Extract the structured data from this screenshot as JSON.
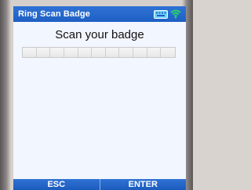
{
  "window": {
    "title": "Ring Scan Badge",
    "status_icons": [
      "keyboard-icon",
      "wifi-icon"
    ]
  },
  "main": {
    "prompt": "Scan your badge",
    "badge_input": {
      "value": "",
      "cell_count": 11
    }
  },
  "softkeys": {
    "esc_label": "ESC",
    "enter_label": "ENTER"
  },
  "colors": {
    "title_bar": "#1f63c6",
    "screen_background": "#f2f6ff",
    "softkey_background": "#1f63c6",
    "text_white": "#ffffff",
    "wifi_icon": "#29d46c",
    "keyboard_icon": "#6fd3ff"
  }
}
